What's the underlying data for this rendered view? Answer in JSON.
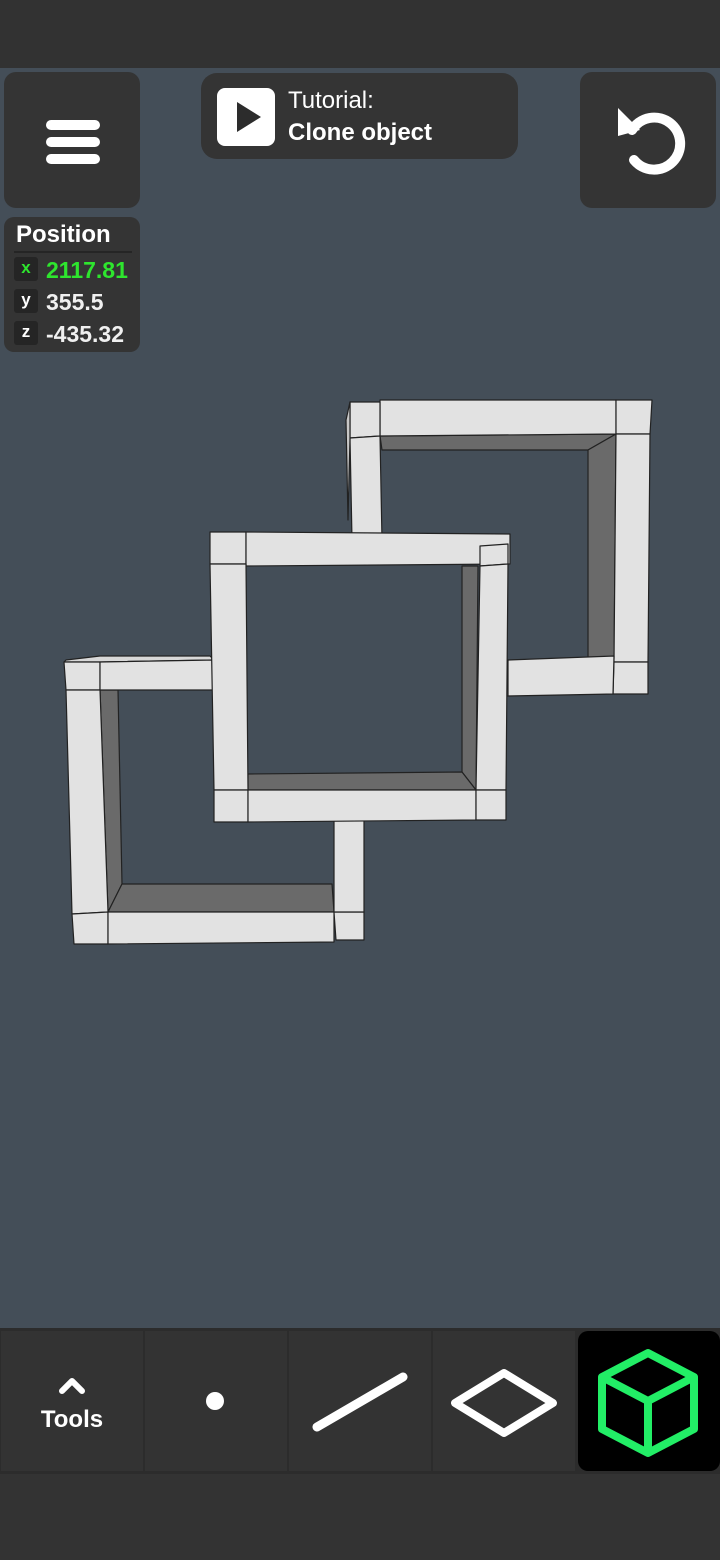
{
  "tutorial": {
    "line1": "Tutorial:",
    "line2": "Clone object"
  },
  "position": {
    "title": "Position",
    "axes": [
      {
        "axis": "x",
        "value": "2117.81"
      },
      {
        "axis": "y",
        "value": "355.5"
      },
      {
        "axis": "z",
        "value": "-435.32"
      }
    ]
  },
  "toolbar": {
    "tools_label": "Tools",
    "icons": [
      "chevron-up-icon",
      "vertex-icon",
      "edge-icon",
      "face-icon",
      "cube-icon"
    ],
    "active_tool": "cube",
    "active_color": "#22ee66"
  },
  "colors": {
    "background": "#444e58",
    "panel": "#343434",
    "highlight": "#2ee52e"
  }
}
